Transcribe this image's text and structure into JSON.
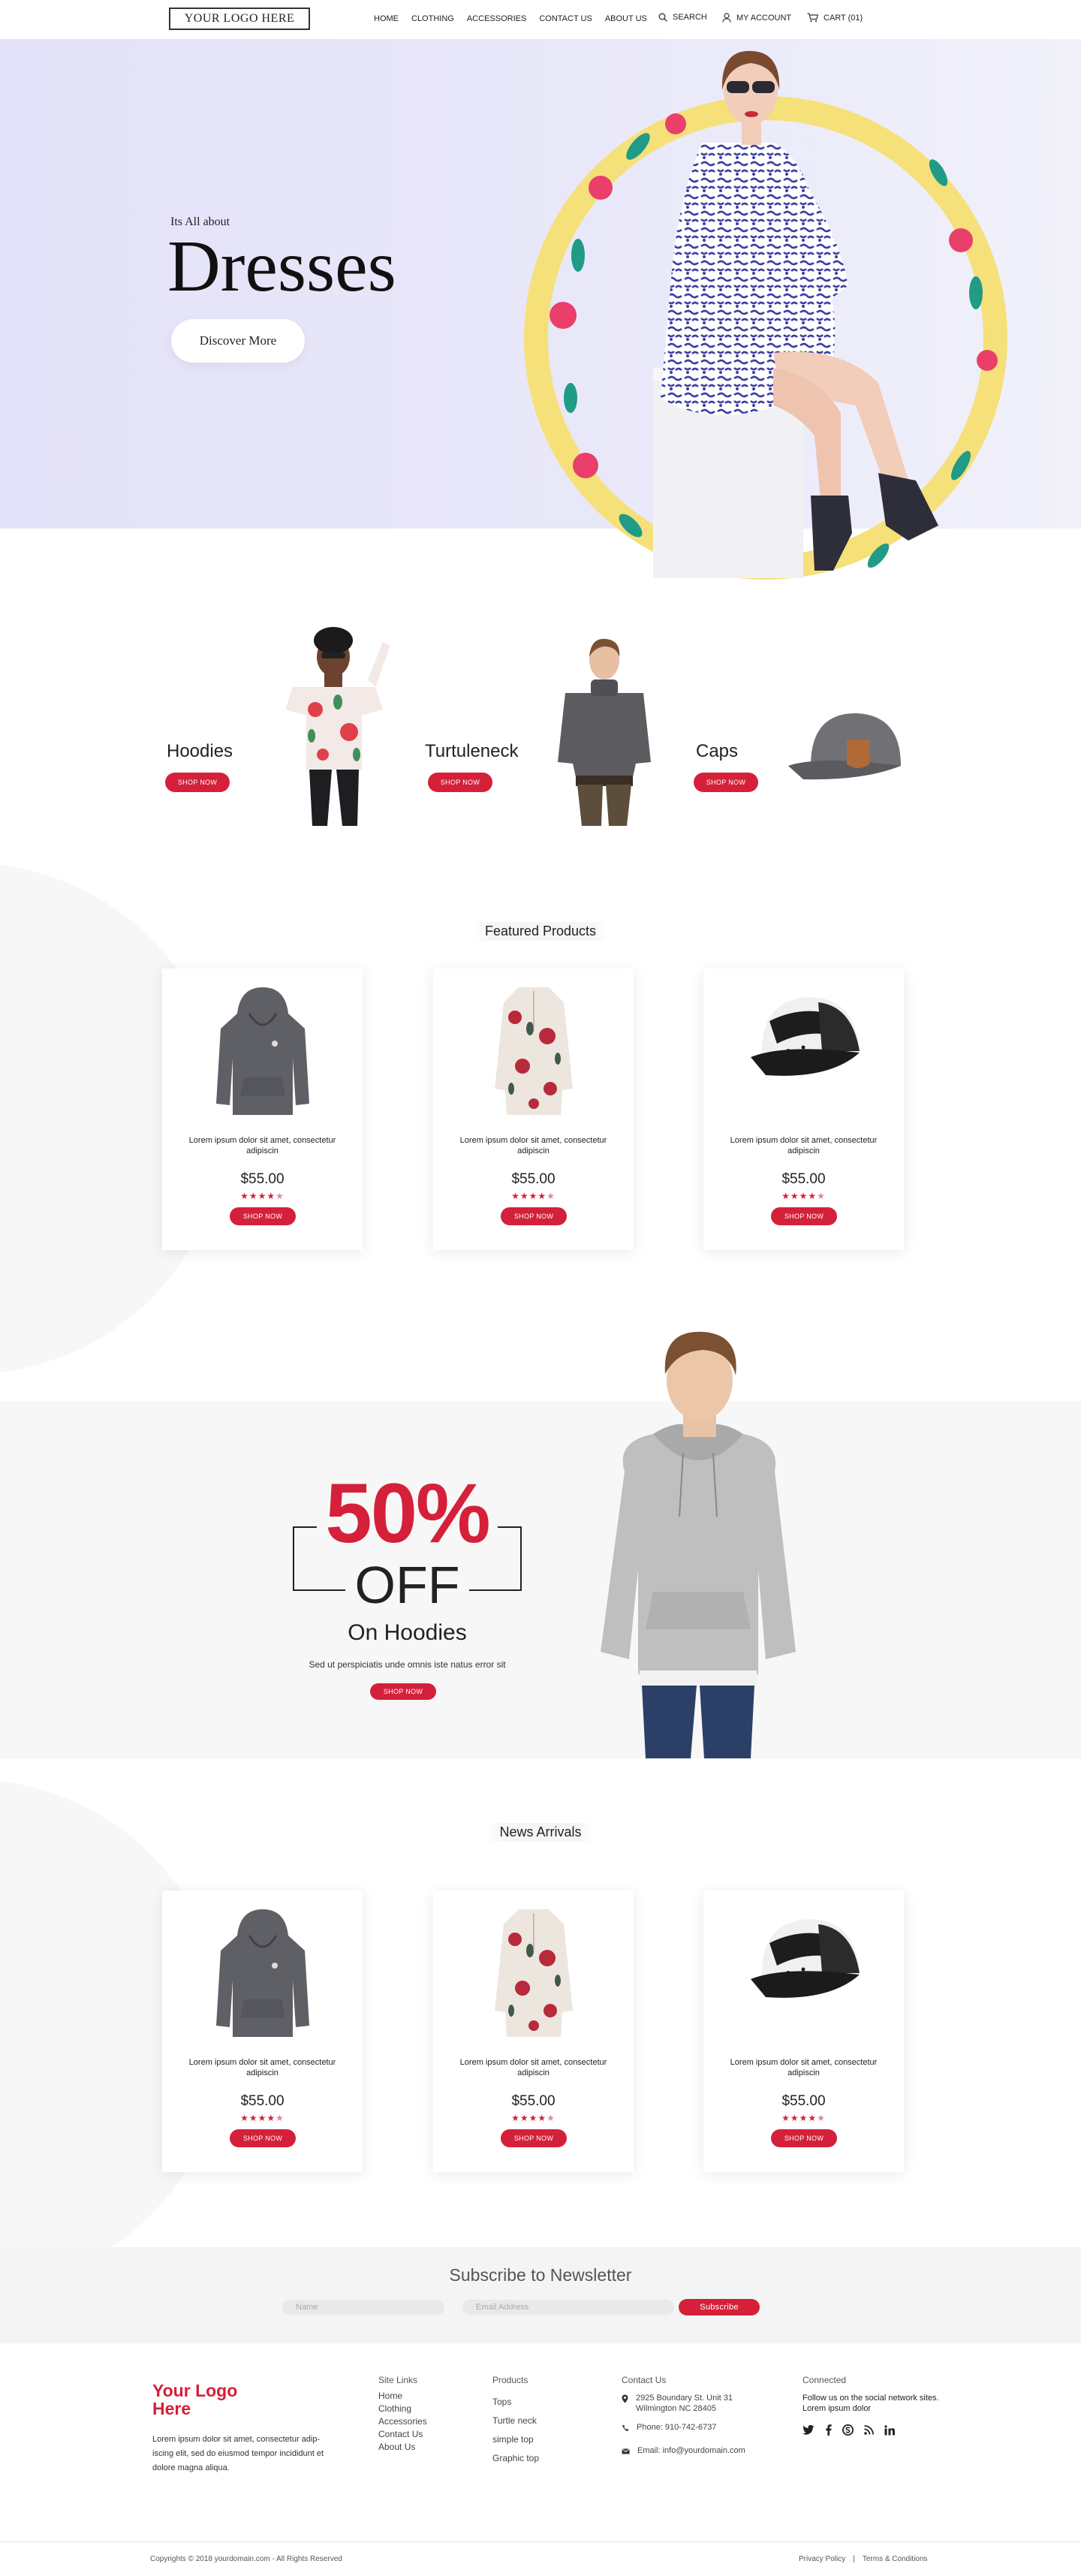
{
  "header": {
    "logo": "YOUR LOGO HERE",
    "nav": [
      "HOME",
      "CLOTHING",
      "ACCESSORIES",
      "CONTACT US",
      "ABOUT US"
    ],
    "search": "SEARCH",
    "account": "MY ACCOUNT",
    "cart": "CART (01)"
  },
  "hero": {
    "kicker": "Its All about",
    "title": "Dresses",
    "button": "Discover More"
  },
  "categories": [
    {
      "label": "Hoodies",
      "button": "SHOP NOW"
    },
    {
      "label": "Turtuleneck",
      "button": "SHOP NOW"
    },
    {
      "label": "Caps",
      "button": "SHOP NOW"
    }
  ],
  "featured": {
    "title": "Featured Products",
    "products": [
      {
        "desc": "Lorem ipsum dolor sit amet, consectetur adipiscin",
        "price": "$55.00",
        "rating": 4.5,
        "button": "SHOP NOW",
        "image": "grey-hoodie"
      },
      {
        "desc": "Lorem ipsum dolor sit amet, consectetur adipiscin",
        "price": "$55.00",
        "rating": 4.5,
        "button": "SHOP NOW",
        "image": "floral-tunic"
      },
      {
        "desc": "Lorem ipsum dolor sit amet, consectetur adipiscin",
        "price": "$55.00",
        "rating": 4.5,
        "button": "SHOP NOW",
        "image": "trucker-cap"
      }
    ]
  },
  "promo": {
    "percent": "50%",
    "off": "OFF",
    "on": "On Hoodies",
    "desc": "Sed ut perspiciatis unde omnis iste natus error sit",
    "button": "SHOP NOW"
  },
  "arrivals": {
    "title": "News Arrivals",
    "products": [
      {
        "desc": "Lorem ipsum dolor sit amet, consectetur adipiscin",
        "price": "$55.00",
        "rating": 4.5,
        "button": "SHOP NOW",
        "image": "grey-hoodie"
      },
      {
        "desc": "Lorem ipsum dolor sit amet, consectetur adipiscin",
        "price": "$55.00",
        "rating": 4.5,
        "button": "SHOP NOW",
        "image": "floral-tunic"
      },
      {
        "desc": "Lorem ipsum dolor sit amet, consectetur adipiscin",
        "price": "$55.00",
        "rating": 4.5,
        "button": "SHOP NOW",
        "image": "trucker-cap"
      }
    ]
  },
  "newsletter": {
    "title": "Subscribe to Newsletter",
    "name_placeholder": "Name",
    "email_placeholder": "Email Address",
    "button": "Subscribe"
  },
  "footer": {
    "logo_line1": "Your Logo",
    "logo_line2": "Here",
    "about": "Lorem ipsum dolor sit amet, consectetur adip- iscing elit, sed do eiusmod tempor incididunt  et dolore magna aliqua.",
    "site_links": {
      "title": "Site Links",
      "items": [
        "Home",
        "Clothing",
        "Accessories",
        "Contact Us",
        "About Us"
      ]
    },
    "products": {
      "title": "Products",
      "items": [
        "Tops",
        "Turtle neck",
        "simple top",
        "Graphic top"
      ]
    },
    "contact": {
      "title": "Contact Us",
      "address": "2925 Boundary St. Unit 31 Wilmington NC 28405",
      "phone": "Phone: 910-742-6737",
      "email": "Email: info@yourdomain.com"
    },
    "connected": {
      "title": "Connected",
      "text": "Follow us on the social network sites. Lorem ipsum dolor"
    },
    "copyright": "Copyrights ©  2018 yourdomain.com  - All Rights Reserved",
    "privacy": "Privacy Policy",
    "sep": "|",
    "terms": "Terms & Conditions"
  },
  "colors": {
    "accent": "#d5203a",
    "hero_bg": "#e6e4f8",
    "section_bg": "#f7f7f7"
  }
}
